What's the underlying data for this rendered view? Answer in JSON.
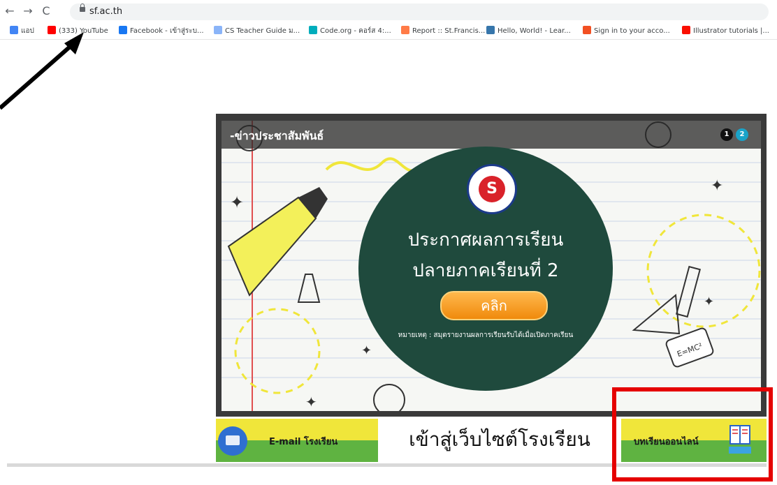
{
  "browser": {
    "nav": {
      "back": "←",
      "forward": "→",
      "reload": "C"
    },
    "url": "sf.ac.th",
    "bookmarks": [
      {
        "label": "แอป",
        "icon": "apps-grid-icon",
        "color": "#4285f4"
      },
      {
        "label": "(333) YouTube",
        "icon": "youtube-icon",
        "color": "#ff0000"
      },
      {
        "label": "Facebook - เข้าสู่ระบ...",
        "icon": "facebook-icon",
        "color": "#1877f2"
      },
      {
        "label": "CS Teacher Guide ม...",
        "icon": "cs-teacher-icon",
        "color": "#8ab4f8"
      },
      {
        "label": "Code.org - คอร์ส 4:...",
        "icon": "codeorg-icon",
        "color": "#00adbc"
      },
      {
        "label": "Report :: St.Francis...",
        "icon": "report-icon",
        "color": "#ff7b47"
      },
      {
        "label": "Hello, World! - Lear...",
        "icon": "python-icon",
        "color": "#3776ab"
      },
      {
        "label": "Sign in to your acco...",
        "icon": "microsoft-icon",
        "color": "#f25022"
      },
      {
        "label": "Illustrator tutorials |...",
        "icon": "adobe-icon",
        "color": "#fa0f00"
      }
    ]
  },
  "banner": {
    "ribbon_title": "-ข่าวประชาสัมพันธ์",
    "pager": [
      "1",
      "2"
    ],
    "headline_line1": "ประกาศผลการเรียน",
    "headline_line2": "ปลายภาคเรียนที่ 2",
    "button_label": "คลิก",
    "note": "หมายเหตุ : สมุดรายงานผลการเรียนรับได้เมื่อเปิดภาคเรียน",
    "seal_letter": "S"
  },
  "bottom_bar": {
    "email_label": "E-mail โรงเรียน",
    "enter_site": "เข้าสู่เว็บไซต์โรงเรียน",
    "online_lessons": "บทเรียนออนไลน์"
  },
  "colors": {
    "accent_yellow": "#f0e63a",
    "accent_green": "#5fb341",
    "circle_green": "#1f4a3d",
    "button_orange": "#f39a1c",
    "highlight_red": "#e50000"
  }
}
